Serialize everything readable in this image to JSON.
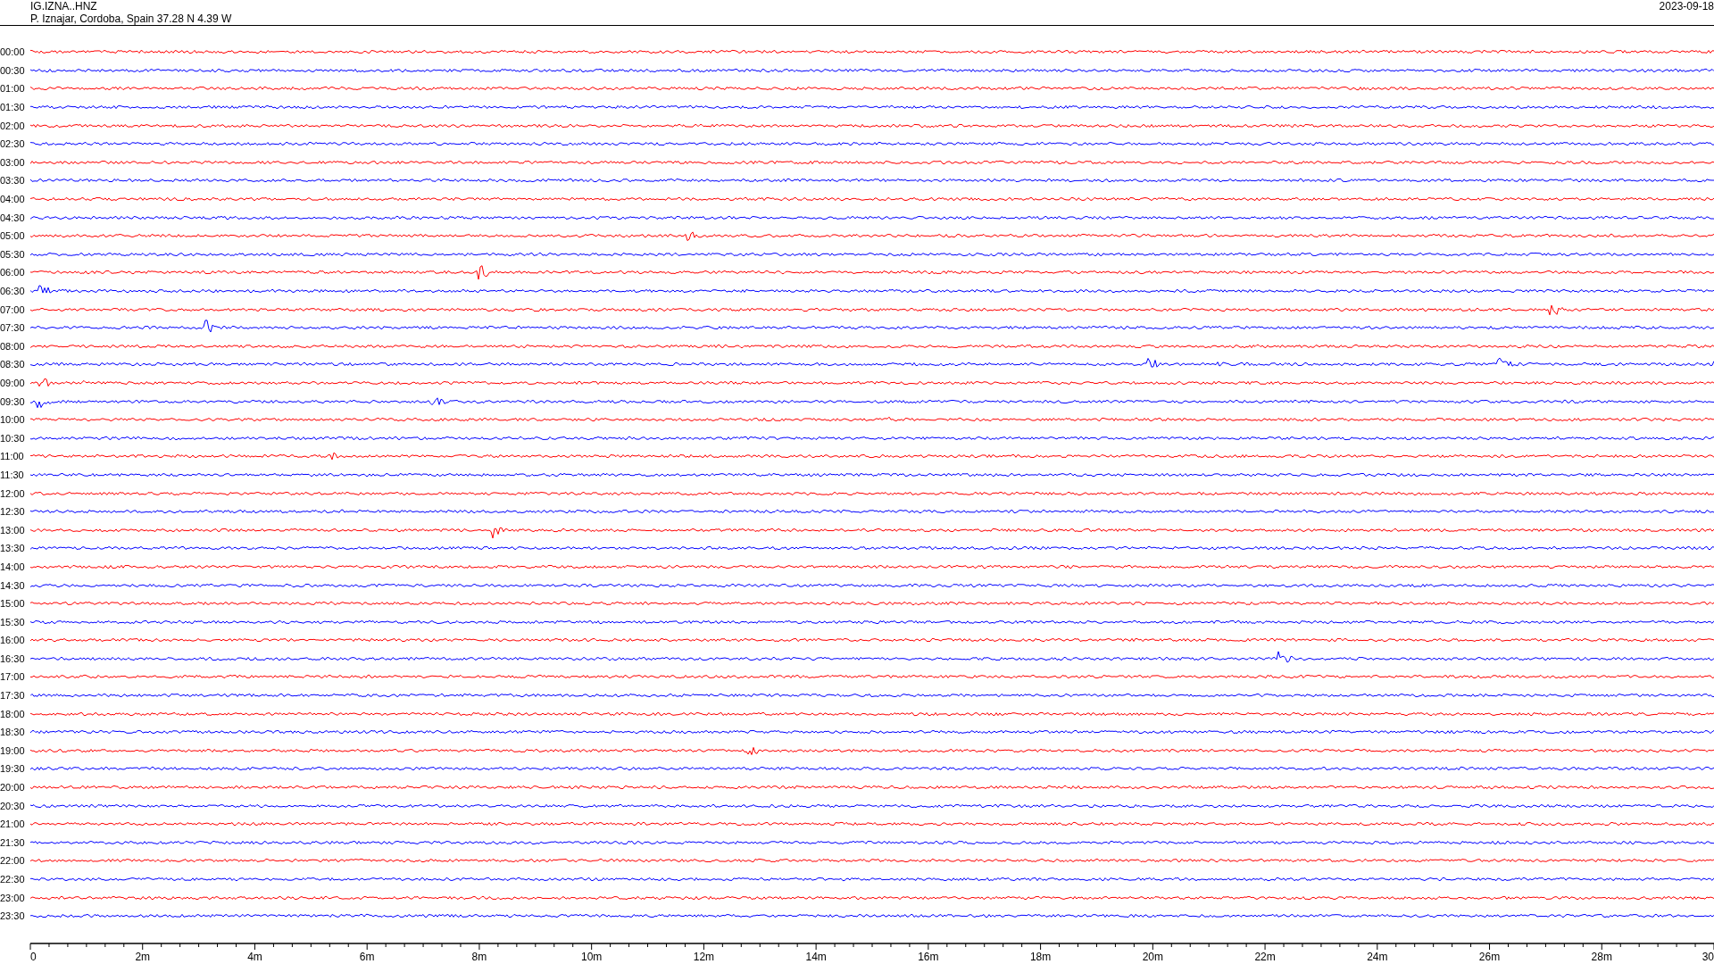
{
  "header": {
    "station": "IG.IZNA..HNZ",
    "location": "P. Iznajar, Cordoba, Spain  37.28 N 4.39 W",
    "date": "2023-09-18"
  },
  "rows": [
    {
      "label": "00:00",
      "color": "#ff0000"
    },
    {
      "label": "00:30",
      "color": "#0000ff"
    },
    {
      "label": "01:00",
      "color": "#ff0000"
    },
    {
      "label": "01:30",
      "color": "#0000ff"
    },
    {
      "label": "02:00",
      "color": "#ff0000"
    },
    {
      "label": "02:30",
      "color": "#0000ff"
    },
    {
      "label": "03:00",
      "color": "#ff0000"
    },
    {
      "label": "03:30",
      "color": "#0000ff"
    },
    {
      "label": "04:00",
      "color": "#ff0000"
    },
    {
      "label": "04:30",
      "color": "#0000ff"
    },
    {
      "label": "05:00",
      "color": "#ff0000"
    },
    {
      "label": "05:30",
      "color": "#0000ff"
    },
    {
      "label": "06:00",
      "color": "#ff0000"
    },
    {
      "label": "06:30",
      "color": "#0000ff"
    },
    {
      "label": "07:00",
      "color": "#ff0000"
    },
    {
      "label": "07:30",
      "color": "#0000ff"
    },
    {
      "label": "08:00",
      "color": "#ff0000"
    },
    {
      "label": "08:30",
      "color": "#0000ff"
    },
    {
      "label": "09:00",
      "color": "#ff0000"
    },
    {
      "label": "09:30",
      "color": "#0000ff"
    },
    {
      "label": "10:00",
      "color": "#ff0000"
    },
    {
      "label": "10:30",
      "color": "#0000ff"
    },
    {
      "label": "11:00",
      "color": "#ff0000"
    },
    {
      "label": "11:30",
      "color": "#0000ff"
    },
    {
      "label": "12:00",
      "color": "#ff0000"
    },
    {
      "label": "12:30",
      "color": "#0000ff"
    },
    {
      "label": "13:00",
      "color": "#ff0000"
    },
    {
      "label": "13:30",
      "color": "#0000ff"
    },
    {
      "label": "14:00",
      "color": "#ff0000"
    },
    {
      "label": "14:30",
      "color": "#0000ff"
    },
    {
      "label": "15:00",
      "color": "#ff0000"
    },
    {
      "label": "15:30",
      "color": "#0000ff"
    },
    {
      "label": "16:00",
      "color": "#ff0000"
    },
    {
      "label": "16:30",
      "color": "#0000ff"
    },
    {
      "label": "17:00",
      "color": "#ff0000"
    },
    {
      "label": "17:30",
      "color": "#0000ff"
    },
    {
      "label": "18:00",
      "color": "#ff0000"
    },
    {
      "label": "18:30",
      "color": "#0000ff"
    },
    {
      "label": "19:00",
      "color": "#ff0000"
    },
    {
      "label": "19:30",
      "color": "#0000ff"
    },
    {
      "label": "20:00",
      "color": "#ff0000"
    },
    {
      "label": "20:30",
      "color": "#0000ff"
    },
    {
      "label": "21:00",
      "color": "#ff0000"
    },
    {
      "label": "21:30",
      "color": "#0000ff"
    },
    {
      "label": "22:00",
      "color": "#ff0000"
    },
    {
      "label": "22:30",
      "color": "#0000ff"
    },
    {
      "label": "23:00",
      "color": "#ff0000"
    },
    {
      "label": "23:30",
      "color": "#0000ff"
    }
  ],
  "x_axis_labels": [
    "0",
    "2m",
    "4m",
    "6m",
    "8m",
    "10m",
    "12m",
    "14m",
    "16m",
    "18m",
    "20m",
    "22m",
    "24m",
    "26m",
    "28m",
    "30"
  ]
}
